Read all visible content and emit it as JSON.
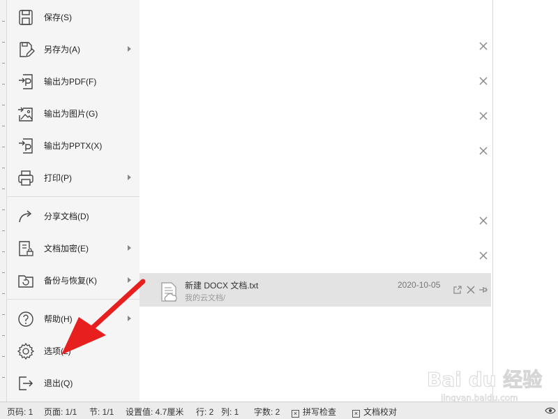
{
  "menu": {
    "items": [
      {
        "label": "保存(S)",
        "icon": "save-icon",
        "submenu": false
      },
      {
        "label": "另存为(A)",
        "icon": "save-as-icon",
        "submenu": true
      },
      {
        "label": "输出为PDF(F)",
        "icon": "export-pdf-icon",
        "submenu": false
      },
      {
        "label": "输出为图片(G)",
        "icon": "export-image-icon",
        "submenu": false
      },
      {
        "label": "输出为PPTX(X)",
        "icon": "export-pptx-icon",
        "submenu": false
      },
      {
        "label": "打印(P)",
        "icon": "print-icon",
        "submenu": true
      },
      {
        "label": "分享文档(D)",
        "icon": "share-icon",
        "submenu": false
      },
      {
        "label": "文档加密(E)",
        "icon": "encrypt-icon",
        "submenu": true
      },
      {
        "label": "备份与恢复(K)",
        "icon": "backup-icon",
        "submenu": true
      },
      {
        "label": "帮助(H)",
        "icon": "help-icon",
        "submenu": true
      },
      {
        "label": "选项(L)",
        "icon": "gear-icon",
        "submenu": false
      },
      {
        "label": "退出(Q)",
        "icon": "exit-icon",
        "submenu": false
      }
    ]
  },
  "recent": {
    "file": {
      "name": "新建 DOCX 文档.txt",
      "path": "我的云文档/",
      "date": "2020-10-05"
    }
  },
  "status": {
    "page": "页码: 1",
    "pages": "页面: 1/1",
    "section": "节: 1/1",
    "setting": "设置值: 4.7厘米",
    "row": "行: 2",
    "col": "列: 1",
    "words": "字数: 2",
    "spell": "拼写检查",
    "proof": "文档校对"
  },
  "watermark": {
    "brand": "Bai du 经验",
    "url": "jingyan.baidu.com"
  },
  "colors": {
    "arrow": "#e81f1f",
    "menu_bg": "#f5f5f5",
    "selected_row": "#e3e3e3"
  }
}
